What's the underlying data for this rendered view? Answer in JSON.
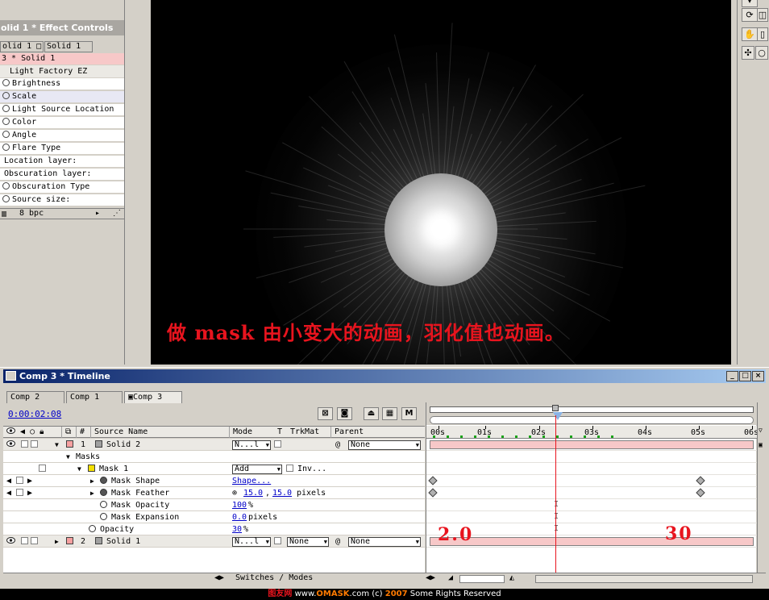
{
  "effect_controls": {
    "title": "olid 1 * Effect Controls",
    "tabs": [
      "olid 1",
      "Solid 1"
    ],
    "layer_header": "3 * Solid 1",
    "effect_name": "Light Factory EZ",
    "properties": [
      {
        "label": "Brightness",
        "stopwatch": true
      },
      {
        "label": "Scale",
        "stopwatch": true,
        "selected": true
      },
      {
        "label": "Light Source Location",
        "stopwatch": true
      },
      {
        "label": "Color",
        "stopwatch": true
      },
      {
        "label": "Angle",
        "stopwatch": true
      },
      {
        "label": "Flare Type",
        "stopwatch": true
      },
      {
        "label": "Location layer:",
        "stopwatch": false
      },
      {
        "label": "Obscuration layer:",
        "stopwatch": false
      },
      {
        "label": "Obscuration Type",
        "stopwatch": true
      },
      {
        "label": "Source size:",
        "stopwatch": true
      }
    ],
    "bottom_label": "8 bpc"
  },
  "viewer": {
    "overlay_text": "做 mask 由小变大的动画，羽化值也动画。"
  },
  "timeline": {
    "title": "Comp 3 * Timeline",
    "tabs": [
      "Comp 2",
      "Comp 1",
      "Comp 3"
    ],
    "timecode": "0:00:02:08",
    "toolbar_m": "M",
    "columns": {
      "source_name": "Source Name",
      "mode": "Mode",
      "t": "T",
      "trkmat": "TrkMat",
      "parent": "Parent",
      "hash": "#"
    },
    "rows": {
      "layer1_num": "1",
      "layer1_name": "Solid 2",
      "layer1_mode": "N...l",
      "layer1_parent": "None",
      "masks_label": "Masks",
      "mask1_label": "Mask 1",
      "mask1_mode": "Add",
      "mask1_inv": "Inv...",
      "mask_shape_label": "Mask Shape",
      "mask_shape_value": "Shape...",
      "mask_feather_label": "Mask Feather",
      "mask_feather_x": "15.0",
      "mask_feather_sep": ",",
      "mask_feather_y": "15.0",
      "mask_feather_unit": "pixels",
      "mask_opacity_label": "Mask Opacity",
      "mask_opacity_value": "100",
      "mask_opacity_unit": "%",
      "mask_expansion_label": "Mask Expansion",
      "mask_expansion_value": "0.0",
      "mask_expansion_unit": "pixels",
      "opacity_label": "Opacity",
      "opacity_value": "30",
      "opacity_unit": "%",
      "layer2_num": "2",
      "layer2_name": "Solid 1",
      "layer2_mode": "N...l",
      "layer2_trkmat": "None",
      "layer2_parent": "None"
    },
    "ruler_ticks": [
      "00s",
      "01s",
      "02s",
      "03s",
      "04s",
      "05s",
      "06s"
    ],
    "annotation_left": "2.0",
    "annotation_right": "30",
    "switches_modes": "Switches / Modes"
  },
  "footer": {
    "brand_cn": "图友网",
    "url_prefix": "www.",
    "url_brand": "OMASK",
    "url_suffix": ".com (c)",
    "year": "2007",
    "rights": "Some Rights Reserved"
  },
  "colors": {
    "layer_bar": "#f7c8c8",
    "cti": "#e8141e",
    "title_gradient_start": "#0a246a"
  }
}
